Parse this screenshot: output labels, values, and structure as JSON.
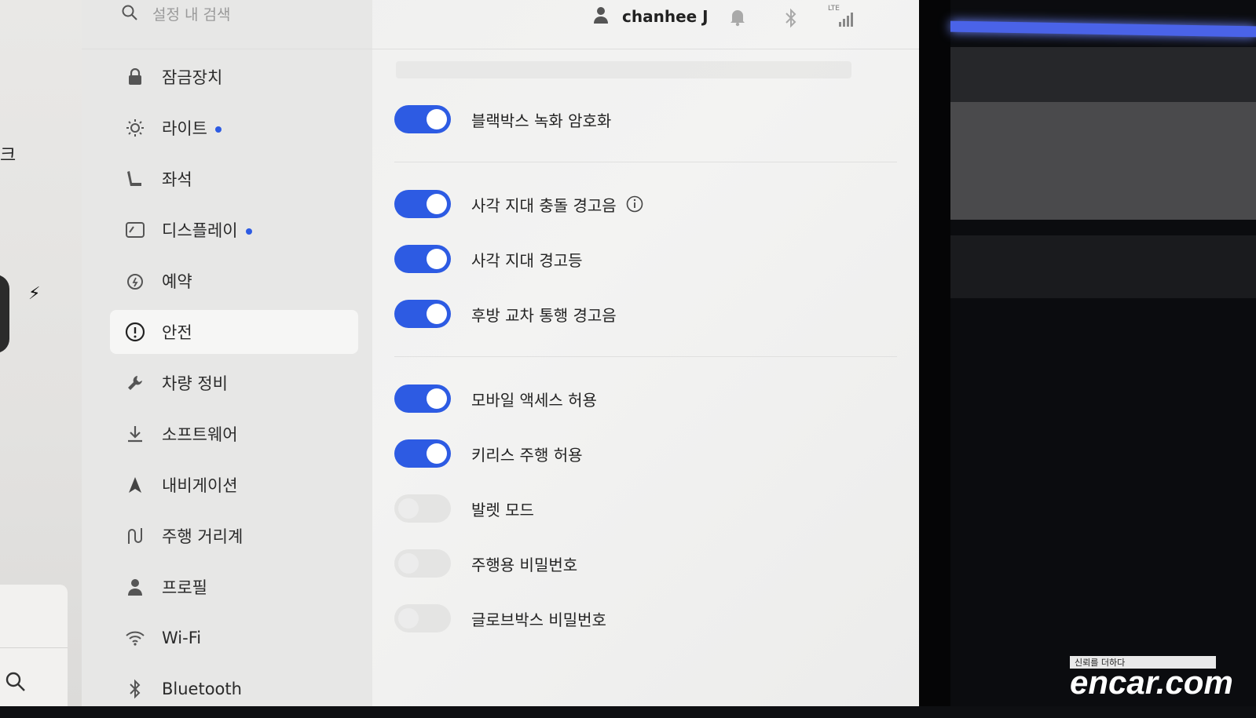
{
  "left_panel": {
    "edge_char": "크"
  },
  "topbar": {
    "search_placeholder": "설정 내 검색",
    "user_name": "chanhee J",
    "signal_label": "LTE"
  },
  "sidebar": {
    "items": [
      {
        "label": "잠금장치",
        "icon": "lock-icon",
        "active": false,
        "dot": false
      },
      {
        "label": "라이트",
        "icon": "sun-icon",
        "active": false,
        "dot": true
      },
      {
        "label": "좌석",
        "icon": "seat-icon",
        "active": false,
        "dot": false
      },
      {
        "label": "디스플레이",
        "icon": "display-icon",
        "active": false,
        "dot": true
      },
      {
        "label": "예약",
        "icon": "alarm-clock-icon",
        "active": false,
        "dot": false
      },
      {
        "label": "안전",
        "icon": "alert-circle-icon",
        "active": true,
        "dot": false
      },
      {
        "label": "차량 정비",
        "icon": "wrench-icon",
        "active": false,
        "dot": false
      },
      {
        "label": "소프트웨어",
        "icon": "download-icon",
        "active": false,
        "dot": false
      },
      {
        "label": "내비게이션",
        "icon": "navigation-icon",
        "active": false,
        "dot": false
      },
      {
        "label": "주행 거리계",
        "icon": "trip-icon",
        "active": false,
        "dot": false
      },
      {
        "label": "프로필",
        "icon": "person-icon",
        "active": false,
        "dot": false
      },
      {
        "label": "Wi-Fi",
        "icon": "wifi-icon",
        "active": false,
        "dot": false
      },
      {
        "label": "Bluetooth",
        "icon": "bluetooth-icon",
        "active": false,
        "dot": false
      }
    ]
  },
  "settings": {
    "dashcam_encrypt": {
      "label": "블랙박스 녹화 암호화",
      "on": true
    },
    "blindspot_chime": {
      "label": "사각 지대 충돌 경고음",
      "on": true,
      "info_icon": "info-icon"
    },
    "blindspot_light": {
      "label": "사각 지대 경고등",
      "on": true
    },
    "rear_cross_traffic": {
      "label": "후방 교차 통행 경고음",
      "on": true
    },
    "mobile_access": {
      "label": "모바일 액세스 허용",
      "on": true
    },
    "keyless_drive": {
      "label": "키리스 주행 허용",
      "on": true
    },
    "valet_mode": {
      "label": "발렛 모드",
      "on": false
    },
    "pin_to_drive": {
      "label": "주행용 비밀번호",
      "on": false
    },
    "glovebox_pin": {
      "label": "글로브박스 비밀번호",
      "on": false
    }
  },
  "watermark": {
    "tagline": "신뢰를 더하다",
    "brand": "encar.com"
  },
  "colors": {
    "accent": "#2d5be3",
    "toggle_off": "#e4e4e3"
  }
}
